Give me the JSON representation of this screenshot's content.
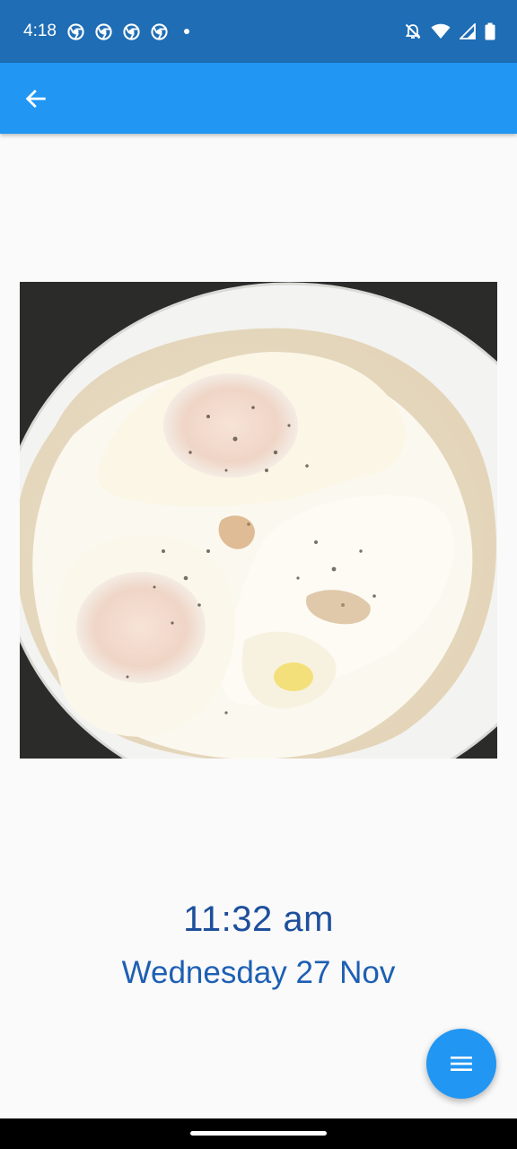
{
  "status_bar": {
    "time": "4:18",
    "notification_icons": [
      "chrome-icon",
      "chrome-icon",
      "chrome-icon",
      "chrome-icon"
    ],
    "status_icons": [
      "bell-off-icon",
      "wifi-icon",
      "signal-icon",
      "battery-icon"
    ]
  },
  "app_bar": {
    "back_icon": "arrow-left-icon",
    "color": "#2196f3"
  },
  "photo": {
    "subject": "food-photo"
  },
  "entry": {
    "time": "11:32 am",
    "date": "Wednesday 27 Nov"
  },
  "fab": {
    "icon": "menu-icon"
  },
  "colors": {
    "status_bar": "#1e6db5",
    "app_bar": "#2196f3",
    "time_text": "#1d4f9c",
    "date_text": "#1d5fb3",
    "fab": "#2196f3"
  }
}
